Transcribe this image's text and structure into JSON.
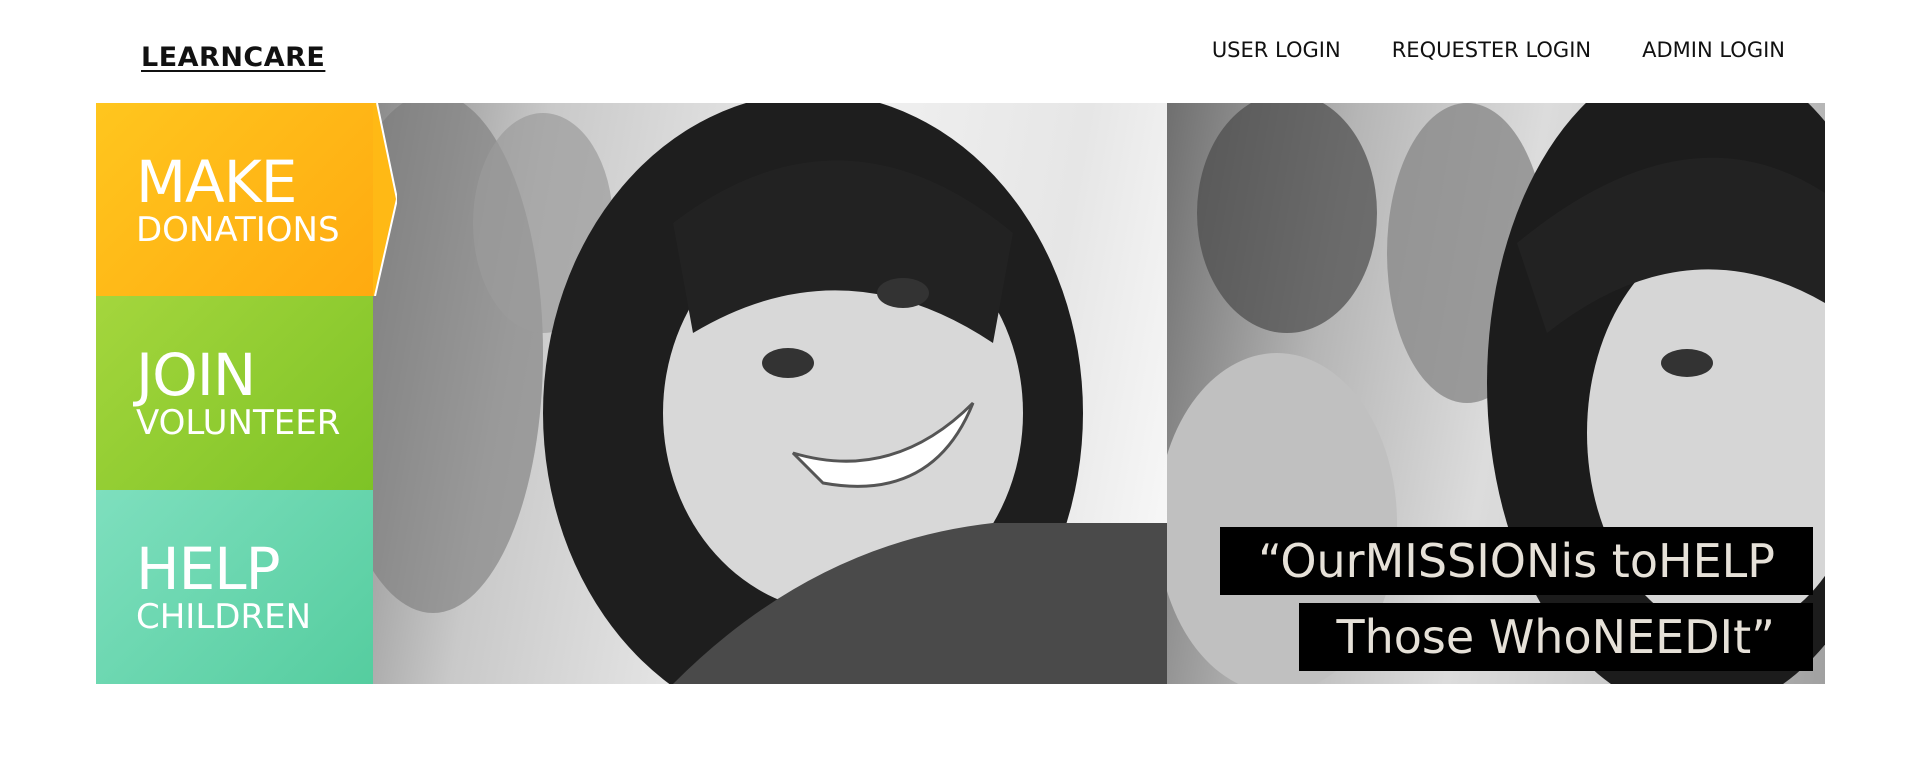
{
  "header": {
    "logo": "LEARNCARE",
    "nav": [
      {
        "label": "USER LOGIN"
      },
      {
        "label": "REQUESTER LOGIN"
      },
      {
        "label": "ADMIN LOGIN"
      }
    ]
  },
  "panels": [
    {
      "big": "MAKE",
      "small": "DONATIONS",
      "color": "#ffb915"
    },
    {
      "big": "JOIN",
      "small": "VOLUNTEER",
      "color": "#92cd30"
    },
    {
      "big": "HELP",
      "small": "CHILDREN",
      "color": "#6ad8b0"
    }
  ],
  "quote": {
    "line1": "“OurMISSIONis toHELP",
    "line2": "Those WhoNEEDIt”"
  },
  "colors": {
    "quote_bg": "#000000",
    "quote_text": "#e6e1d8"
  }
}
